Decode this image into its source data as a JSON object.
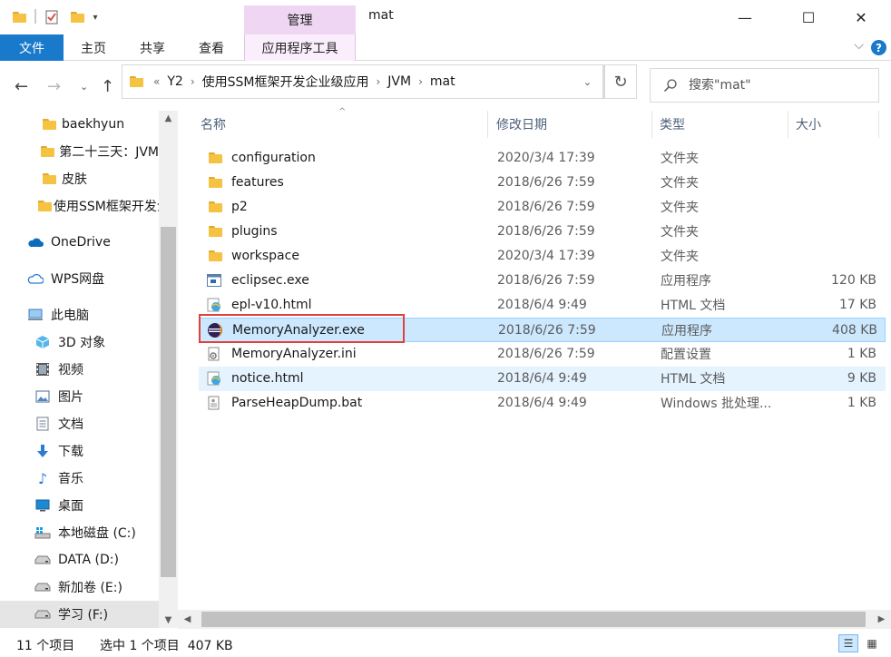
{
  "window": {
    "title": "mat",
    "contextual_tab_group": "管理",
    "controls": {
      "minimize": "—",
      "maximize": "☐",
      "close": "✕"
    }
  },
  "ribbon": {
    "tabs": [
      {
        "label": "文件"
      },
      {
        "label": "主页"
      },
      {
        "label": "共享"
      },
      {
        "label": "查看"
      },
      {
        "label": "应用程序工具"
      }
    ],
    "help": "?"
  },
  "address": {
    "overflow": "«",
    "crumbs": [
      "Y2",
      "使用SSM框架开发企业级应用",
      "JVM",
      "mat"
    ],
    "search_placeholder": "搜索\"mat\""
  },
  "nav": {
    "items": [
      {
        "label": "baekhyun",
        "icon": "folder-icon"
      },
      {
        "label": "第二十三天：JVM",
        "icon": "folder-icon"
      },
      {
        "label": "皮肤",
        "icon": "folder-icon"
      },
      {
        "label": "使用SSM框架开发企业级应用",
        "icon": "folder-icon"
      },
      {
        "label": "OneDrive",
        "icon": "onedrive-icon"
      },
      {
        "label": "WPS网盘",
        "icon": "cloud-icon"
      },
      {
        "label": "此电脑",
        "icon": "computer-icon"
      },
      {
        "label": "3D 对象",
        "icon": "cube-icon"
      },
      {
        "label": "视频",
        "icon": "video-icon"
      },
      {
        "label": "图片",
        "icon": "picture-icon"
      },
      {
        "label": "文档",
        "icon": "document-icon"
      },
      {
        "label": "下载",
        "icon": "download-icon"
      },
      {
        "label": "音乐",
        "icon": "music-icon"
      },
      {
        "label": "桌面",
        "icon": "desktop-icon"
      },
      {
        "label": "本地磁盘 (C:)",
        "icon": "windows-drive-icon"
      },
      {
        "label": "DATA (D:)",
        "icon": "drive-icon"
      },
      {
        "label": "新加卷 (E:)",
        "icon": "drive-icon"
      },
      {
        "label": "学习 (F:)",
        "icon": "drive-icon"
      }
    ]
  },
  "columns": {
    "name": "名称",
    "date": "修改日期",
    "type": "类型",
    "size": "大小"
  },
  "files": [
    {
      "name": "configuration",
      "date": "2020/3/4 17:39",
      "type": "文件夹",
      "size": "",
      "icon": "folder-icon"
    },
    {
      "name": "features",
      "date": "2018/6/26 7:59",
      "type": "文件夹",
      "size": "",
      "icon": "folder-icon"
    },
    {
      "name": "p2",
      "date": "2018/6/26 7:59",
      "type": "文件夹",
      "size": "",
      "icon": "folder-icon"
    },
    {
      "name": "plugins",
      "date": "2018/6/26 7:59",
      "type": "文件夹",
      "size": "",
      "icon": "folder-icon"
    },
    {
      "name": "workspace",
      "date": "2020/3/4 17:39",
      "type": "文件夹",
      "size": "",
      "icon": "folder-icon"
    },
    {
      "name": "eclipsec.exe",
      "date": "2018/6/26 7:59",
      "type": "应用程序",
      "size": "120 KB",
      "icon": "exe-icon"
    },
    {
      "name": "epl-v10.html",
      "date": "2018/6/4 9:49",
      "type": "HTML 文档",
      "size": "17 KB",
      "icon": "html-icon"
    },
    {
      "name": "MemoryAnalyzer.exe",
      "date": "2018/6/26 7:59",
      "type": "应用程序",
      "size": "408 KB",
      "icon": "eclipse-icon"
    },
    {
      "name": "MemoryAnalyzer.ini",
      "date": "2018/6/26 7:59",
      "type": "配置设置",
      "size": "1 KB",
      "icon": "ini-icon"
    },
    {
      "name": "notice.html",
      "date": "2018/6/4 9:49",
      "type": "HTML 文档",
      "size": "9 KB",
      "icon": "html-icon"
    },
    {
      "name": "ParseHeapDump.bat",
      "date": "2018/6/4 9:49",
      "type": "Windows 批处理...",
      "size": "1 KB",
      "icon": "bat-icon"
    }
  ],
  "selected_index": 7,
  "hover_index": 9,
  "status": {
    "count": "11 个项目",
    "selection": "选中 1 个项目  407 KB"
  },
  "colors": {
    "accent": "#1979ca",
    "selection": "#cce8ff",
    "highlight_box": "#e0413a",
    "context_tab": "#efd6f2"
  }
}
